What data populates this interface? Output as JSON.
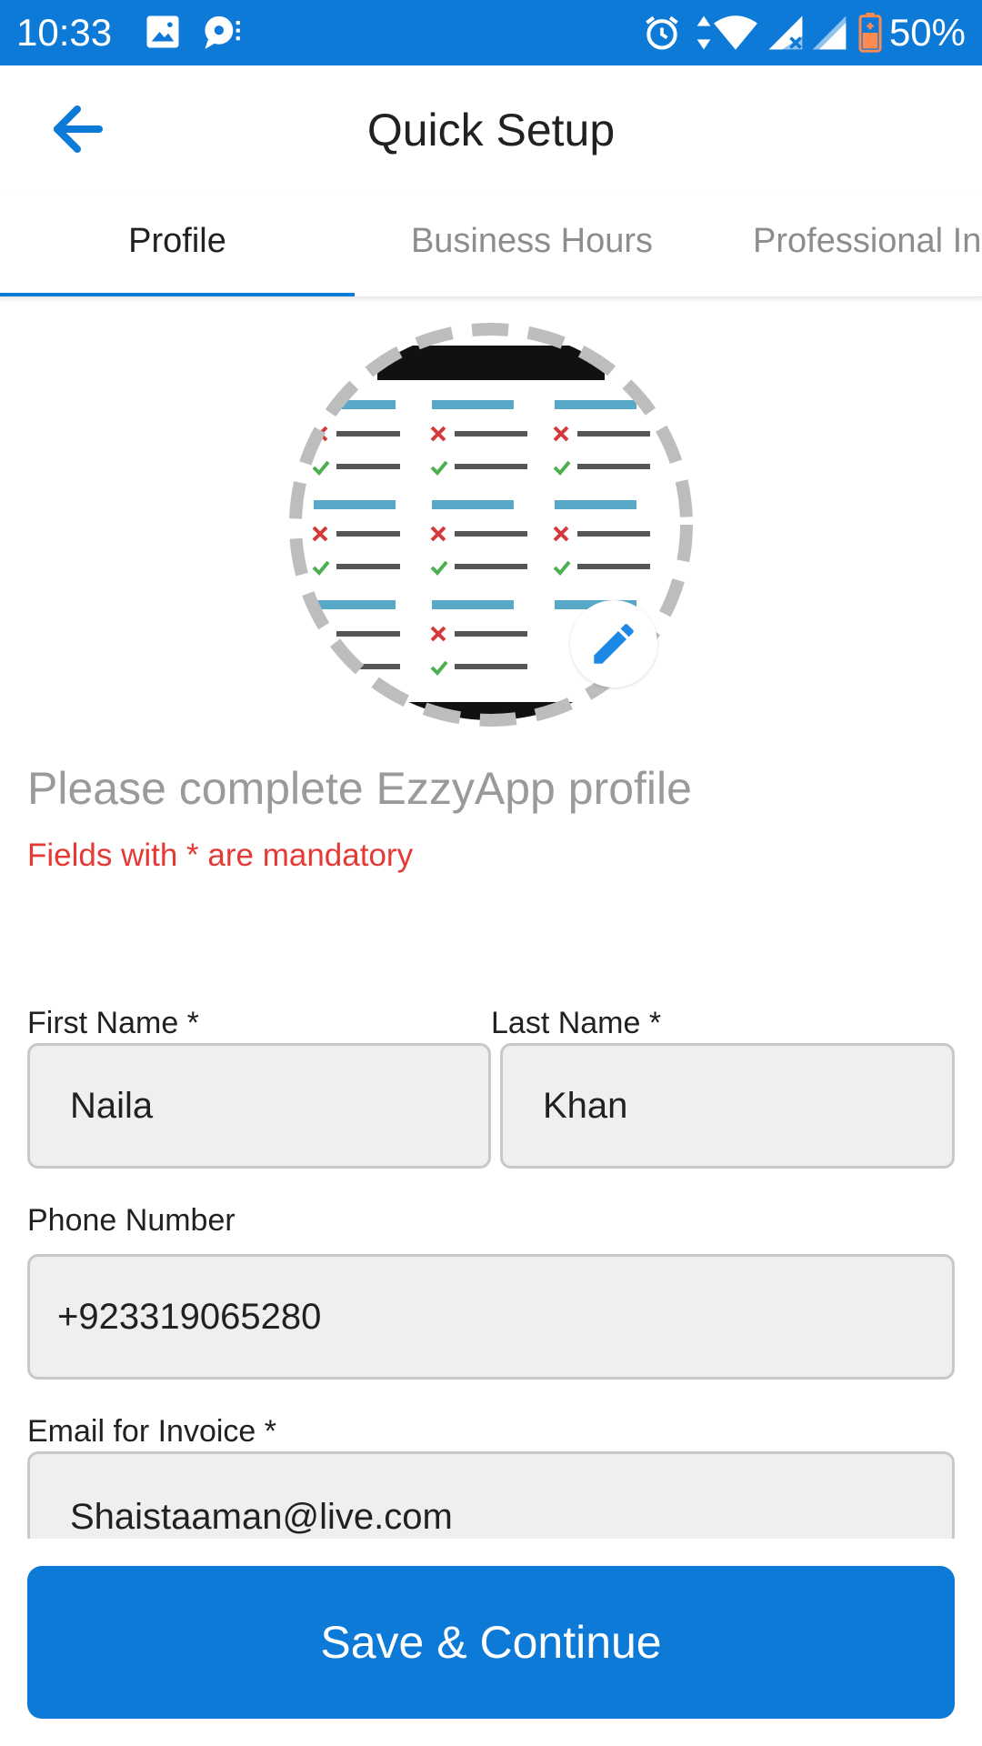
{
  "status_bar": {
    "time": "10:33",
    "battery": "50%",
    "icons": [
      "image-icon",
      "chat-icon",
      "alarm-icon",
      "data-arrows-icon",
      "wifi-icon",
      "signal-x-icon",
      "signal-icon",
      "battery-charging-icon"
    ]
  },
  "app_bar": {
    "title": "Quick Setup",
    "back_icon": "arrow-left-icon"
  },
  "tabs": [
    {
      "label": "Profile",
      "active": true
    },
    {
      "label": "Business Hours",
      "active": false
    },
    {
      "label": "Professional In",
      "active": false
    }
  ],
  "avatar": {
    "edit_icon": "pencil-icon"
  },
  "intro": {
    "heading": "Please complete EzzyApp profile",
    "note": "Fields with * are mandatory"
  },
  "form": {
    "first_name": {
      "label": "First Name *",
      "value": "Naila"
    },
    "last_name": {
      "label": "Last Name *",
      "value": "Khan"
    },
    "phone": {
      "label": "Phone Number",
      "value": "+923319065280"
    },
    "email": {
      "label": "Email for Invoice *",
      "value": "Shaistaaman@live.com"
    }
  },
  "actions": {
    "save_label": "Save & Continue"
  },
  "colors": {
    "primary": "#0d7ad8",
    "error": "#e53935",
    "field_bg": "#efefef"
  }
}
